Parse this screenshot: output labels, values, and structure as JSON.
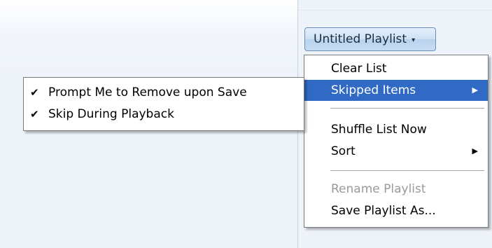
{
  "playlist_button": {
    "label": "Untitled Playlist",
    "caret": "▾"
  },
  "main_menu": {
    "items": [
      {
        "label": "Clear List"
      },
      {
        "label": "Skipped Items",
        "submenu_arrow": "▶",
        "state": "highlighted"
      },
      {
        "label": "Shuffle List Now"
      },
      {
        "label": "Sort",
        "submenu_arrow": "▶"
      },
      {
        "label": "Rename Playlist",
        "state": "disabled"
      },
      {
        "label": "Save Playlist As..."
      }
    ]
  },
  "skipped_items_submenu": {
    "items": [
      {
        "label": "Prompt Me to Remove upon Save",
        "checked": true,
        "check_glyph": "✔"
      },
      {
        "label": "Skip During Playback",
        "checked": true,
        "check_glyph": "✔"
      }
    ]
  },
  "colors": {
    "highlight": "#316ac5",
    "disabled_text": "#9a9a9a",
    "pane_background": "#eef3fa",
    "button_border": "#6d8fb5"
  }
}
